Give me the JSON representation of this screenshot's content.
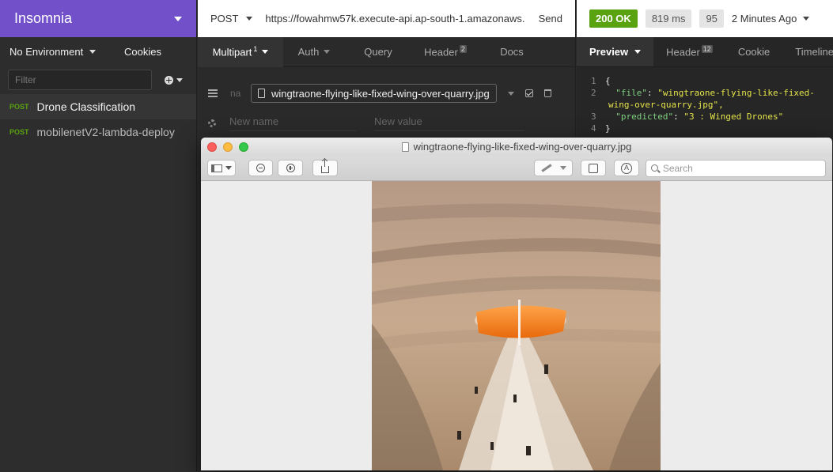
{
  "app": {
    "name": "Insomnia",
    "environment": "No Environment",
    "cookies_label": "Cookies",
    "filter_placeholder": "Filter"
  },
  "sidebar": {
    "requests": [
      {
        "method": "POST",
        "label": "Drone Classification",
        "active": true
      },
      {
        "method": "POST",
        "label": "mobilenetV2-lambda-deploy",
        "active": false
      }
    ]
  },
  "request": {
    "method": "POST",
    "url": "https://fowahmw57k.execute-api.ap-south-1.amazonaws.",
    "send_label": "Send",
    "tabs": [
      {
        "label": "Multipart",
        "badge": "1"
      },
      {
        "label": "Auth"
      },
      {
        "label": "Query"
      },
      {
        "label": "Header",
        "badge": "2"
      },
      {
        "label": "Docs"
      }
    ],
    "param_name_placeholder": "na",
    "file_name": "wingtraone-flying-like-fixed-wing-over-quarry.jpg",
    "new_name_placeholder": "New name",
    "new_value_placeholder": "New value"
  },
  "response": {
    "status": "200 OK",
    "time": "819 ms",
    "size": "95",
    "ago": "2 Minutes Ago",
    "tabs": [
      {
        "label": "Preview"
      },
      {
        "label": "Header",
        "badge": "12"
      },
      {
        "label": "Cookie"
      },
      {
        "label": "Timeline"
      }
    ],
    "body": {
      "l1": "{",
      "file_key": "\"file\"",
      "file_val_1": "\"wingtraone-flying-like-fixed-",
      "file_val_2": "wing-over-quarry.jpg\",",
      "pred_key": "\"predicted\"",
      "pred_val": "\"3 : Winged Drones\"",
      "l4": "}"
    }
  },
  "preview_window": {
    "title": "wingtraone-flying-like-fixed-wing-over-quarry.jpg",
    "search_placeholder": "Search"
  },
  "colors": {
    "brand": "#7250c9",
    "ok": "#59a210",
    "json_key": "#80d080",
    "json_string": "#e3e34a"
  }
}
